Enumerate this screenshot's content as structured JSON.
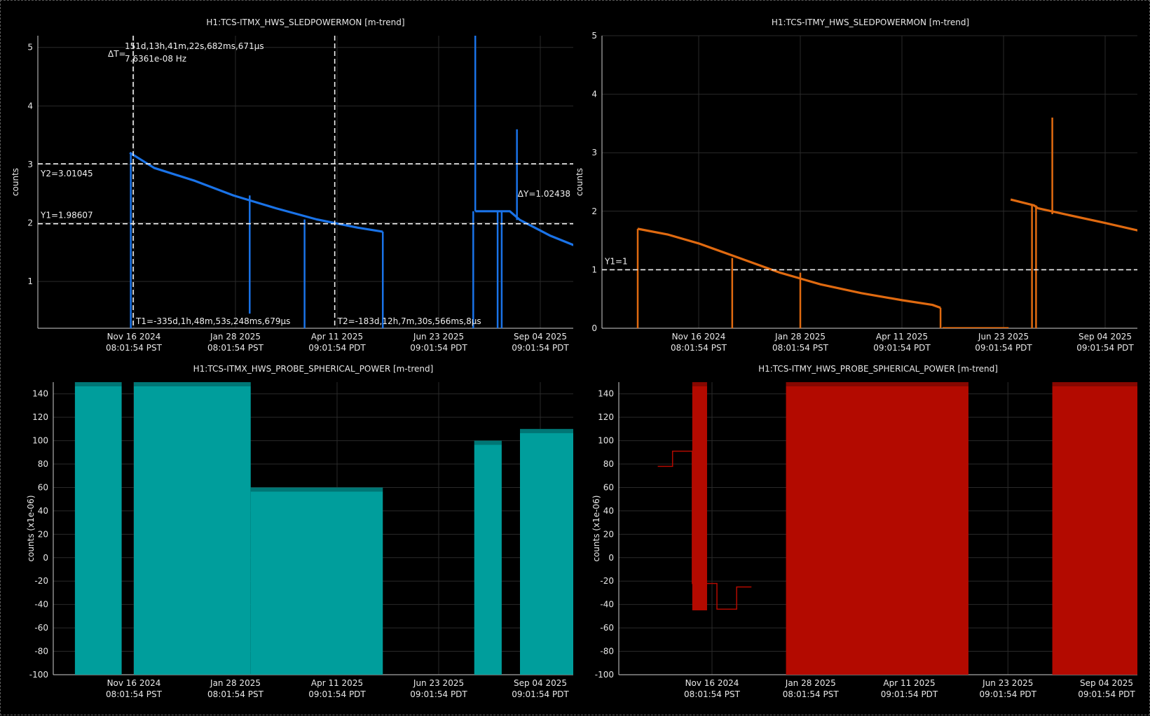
{
  "chart_data": [
    {
      "type": "line",
      "title": "H1:TCS-ITMX_HWS_SLEDPOWERMON [m-trend]",
      "ylabel": "counts",
      "color": "#1a73e8",
      "ylim": [
        0.2,
        5.2
      ],
      "yticks": [
        "1",
        "2",
        "3",
        "4",
        "5"
      ],
      "xticks": [
        {
          "line1": "Nov 16 2024",
          "line2": "08:01:54 PST"
        },
        {
          "line1": "Jan 28 2025",
          "line2": "08:01:54 PST"
        },
        {
          "line1": "Apr 11 2025",
          "line2": "09:01:54 PDT"
        },
        {
          "line1": "Jun 23 2025",
          "line2": "09:01:54 PDT"
        },
        {
          "line1": "Sep 04 2025",
          "line2": "09:01:54 PDT"
        }
      ],
      "series": [
        {
          "values": [
            [
              -0.04,
              3.2
            ],
            [
              0.2,
              2.94
            ],
            [
              0.6,
              2.72
            ],
            [
              0.98,
              2.47
            ],
            [
              1.4,
              2.25
            ],
            [
              1.8,
              2.06
            ],
            [
              2.2,
              1.92
            ],
            [
              2.45,
              1.85
            ]
          ]
        },
        {
          "values": [
            [
              3.36,
              2.2
            ],
            [
              3.7,
              2.2
            ],
            [
              3.8,
              2.05
            ],
            [
              4.1,
              1.78
            ],
            [
              4.5,
              1.5
            ],
            [
              4.9,
              1.25
            ],
            [
              5.2,
              1.1
            ]
          ]
        }
      ],
      "drops": [
        [
          -0.03,
          0.2
        ],
        [
          1.14,
          0.45
        ],
        [
          1.68,
          0.2
        ],
        [
          2.45,
          0.2
        ],
        [
          3.34,
          0.2
        ],
        [
          3.58,
          0.2
        ],
        [
          3.62,
          0.2
        ]
      ],
      "spikes": [
        [
          3.36,
          5.2
        ],
        [
          3.77,
          3.6
        ]
      ],
      "cursors": {
        "y1": {
          "value": 1.98607,
          "label": "Y1=1.98607"
        },
        "y2": {
          "value": 3.01045,
          "label": "Y2=3.01045"
        },
        "t1": {
          "x": 0.09,
          "label": "T1=-335d,1h,48m,53s,248ms,679µs"
        },
        "t2": {
          "x": 2.17,
          "label": "T2=-183d,12h,7m,30s,566ms,8µs"
        },
        "dt_prefix": "ΔT=",
        "dt_line1": "151d,13h,41m,22s,682ms,671µs",
        "dt_line2": "7.6361e-08 Hz",
        "dy": "ΔY=1.02438"
      }
    },
    {
      "type": "line",
      "title": "H1:TCS-ITMY_HWS_SLEDPOWERMON [m-trend]",
      "ylabel": "counts",
      "color": "#e06a10",
      "ylim": [
        0,
        5
      ],
      "yticks": [
        "0",
        "1",
        "2",
        "3",
        "4",
        "5"
      ],
      "xticks": [
        {
          "line1": "Nov 16 2024",
          "line2": "08:01:54 PST"
        },
        {
          "line1": "Jan 28 2025",
          "line2": "08:01:54 PST"
        },
        {
          "line1": "Apr 11 2025",
          "line2": "09:01:54 PDT"
        },
        {
          "line1": "Jun 23 2025",
          "line2": "09:01:54 PDT"
        },
        {
          "line1": "Sep 04 2025",
          "line2": "09:01:54 PDT"
        }
      ],
      "series": [
        {
          "values": [
            [
              -0.6,
              1.7
            ],
            [
              -0.3,
              1.6
            ],
            [
              0.0,
              1.45
            ],
            [
              0.4,
              1.2
            ],
            [
              0.8,
              0.95
            ],
            [
              1.2,
              0.75
            ],
            [
              1.6,
              0.6
            ],
            [
              2.0,
              0.48
            ],
            [
              2.3,
              0.4
            ],
            [
              2.38,
              0.35
            ]
          ]
        },
        {
          "values": [
            [
              2.4,
              0.0
            ],
            [
              3.05,
              0.0
            ]
          ]
        },
        {
          "values": [
            [
              3.07,
              2.2
            ],
            [
              3.3,
              2.1
            ],
            [
              3.34,
              2.05
            ],
            [
              3.6,
              1.95
            ],
            [
              4.0,
              1.8
            ],
            [
              4.5,
              1.6
            ],
            [
              4.83,
              1.48
            ]
          ]
        }
      ],
      "drops": [
        [
          -0.6,
          0.0
        ],
        [
          0.33,
          0.0
        ],
        [
          1.0,
          0.0
        ],
        [
          2.38,
          0.0
        ],
        [
          3.28,
          0.0
        ],
        [
          3.32,
          0.0
        ]
      ],
      "spikes": [
        [
          3.48,
          3.6
        ]
      ],
      "cursors": {
        "y1": {
          "value": 1,
          "label": "Y1=1"
        }
      }
    },
    {
      "type": "area",
      "title": "H1:TCS-ITMX_HWS_PROBE_SPHERICAL_POWER [m-trend]",
      "ylabel": "counts (x1e-06)",
      "color": "#009e9c",
      "ylim": [
        -100,
        150
      ],
      "yticks": [
        "-100",
        "-80",
        "-60",
        "-40",
        "-20",
        "0",
        "20",
        "40",
        "60",
        "80",
        "100",
        "120",
        "140"
      ],
      "xticks": [
        {
          "line1": "Nov 16 2024",
          "line2": "08:01:54 PST"
        },
        {
          "line1": "Jan 28 2025",
          "line2": "08:01:54 PST"
        },
        {
          "line1": "Apr 11 2025",
          "line2": "09:01:54 PDT"
        },
        {
          "line1": "Jun 23 2025",
          "line2": "09:01:54 PDT"
        },
        {
          "line1": "Sep 04 2025",
          "line2": "09:01:54 PDT"
        }
      ],
      "bands": [
        {
          "x0": -0.58,
          "x1": -0.12,
          "min": -100,
          "max": 150
        },
        {
          "x0": 0.0,
          "x1": 1.15,
          "min": -100,
          "max": 150
        },
        {
          "x0": 1.15,
          "x1": 2.45,
          "min": -100,
          "max": 60
        },
        {
          "x0": 3.35,
          "x1": 3.62,
          "min": -100,
          "max": 100
        },
        {
          "x0": 3.8,
          "x1": 5.05,
          "min": -100,
          "max": 110
        }
      ]
    },
    {
      "type": "area",
      "title": "H1:TCS-ITMY_HWS_PROBE_SPHERICAL_POWER [m-trend]",
      "ylabel": "counts (x1e-06)",
      "color": "#b30a00",
      "ylim": [
        -100,
        150
      ],
      "yticks": [
        "-100",
        "-80",
        "-60",
        "-40",
        "-20",
        "0",
        "20",
        "40",
        "60",
        "80",
        "100",
        "120",
        "140"
      ],
      "xticks": [
        {
          "line1": "Nov 16 2024",
          "line2": "08:01:54 PST"
        },
        {
          "line1": "Jan 28 2025",
          "line2": "08:01:54 PST"
        },
        {
          "line1": "Apr 11 2025",
          "line2": "09:01:54 PDT"
        },
        {
          "line1": "Jun 23 2025",
          "line2": "09:01:54 PDT"
        },
        {
          "line1": "Sep 04 2025",
          "line2": "09:01:54 PDT"
        }
      ],
      "bands": [
        {
          "x0": -0.2,
          "x1": -0.05,
          "min": -45,
          "max": 150
        },
        {
          "x0": 0.75,
          "x1": 2.6,
          "min": -100,
          "max": 150
        },
        {
          "x0": 3.45,
          "x1": 4.97,
          "min": -100,
          "max": 150
        }
      ],
      "steps": [
        [
          -0.55,
          78
        ],
        [
          -0.4,
          78
        ],
        [
          -0.4,
          91
        ],
        [
          -0.2,
          91
        ],
        [
          -0.2,
          -22
        ],
        [
          0.05,
          -22
        ],
        [
          0.05,
          -44
        ],
        [
          0.25,
          -44
        ],
        [
          0.25,
          -25
        ],
        [
          0.4,
          -25
        ]
      ]
    }
  ]
}
